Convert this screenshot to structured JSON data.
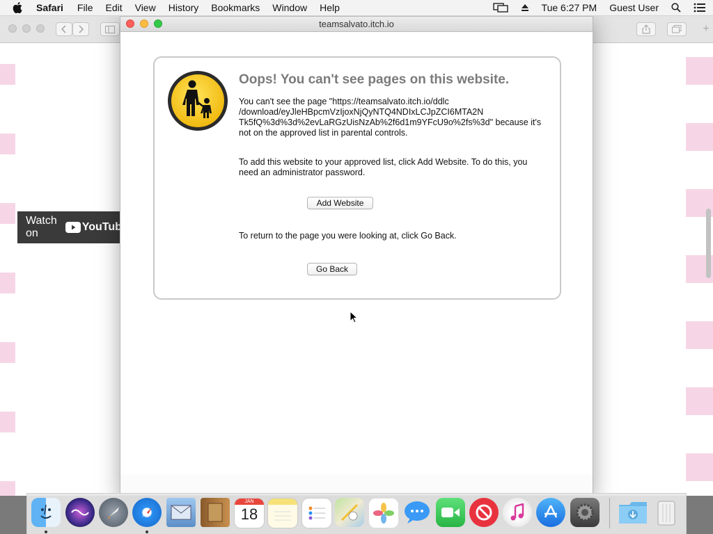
{
  "menubar": {
    "app_name": "Safari",
    "menus": [
      "File",
      "Edit",
      "View",
      "History",
      "Bookmarks",
      "Window",
      "Help"
    ],
    "clock": "Tue 6:27 PM",
    "user": "Guest User"
  },
  "background_page": {
    "watch_on": "Watch on",
    "youtube": "YouTube"
  },
  "window": {
    "title": "teamsalvato.itch.io"
  },
  "block_page": {
    "heading": "Oops! You can't see pages on this website.",
    "message_url": "You can't see the page \"https://teamsalvato.itch.io/ddlc\n/download/eyJleHBpcmVzIjoxNjQyNTQ4NDIxLCJpZCI6MTA2N\nTk5fQ%3d%3d%2evLaRGzUisNzAb%2f6d1m9YFcU9o%2fs%3d\" because it's\nnot on the approved list in parental controls.",
    "message_add": "To add this website to your approved list, click Add Website. To do this, you need an administrator password.",
    "add_button": "Add Website",
    "message_back": "To return to the page you were looking at, click Go Back.",
    "back_button": "Go Back"
  },
  "dock": {
    "apps": [
      "Finder",
      "Siri",
      "Launchpad",
      "Safari",
      "Mail",
      "Contacts",
      "Calendar",
      "Notes",
      "Reminders",
      "Maps",
      "Photos",
      "Messages",
      "FaceTime",
      "News",
      "iTunes",
      "App Store",
      "System Preferences",
      "Downloads",
      "Trash"
    ],
    "calendar_month": "JAN",
    "calendar_day": "18"
  },
  "colors": {
    "close": "#fc605b",
    "minimize": "#fdbc40",
    "zoom": "#34c84a",
    "badge_yellow": "#f5c82a"
  }
}
